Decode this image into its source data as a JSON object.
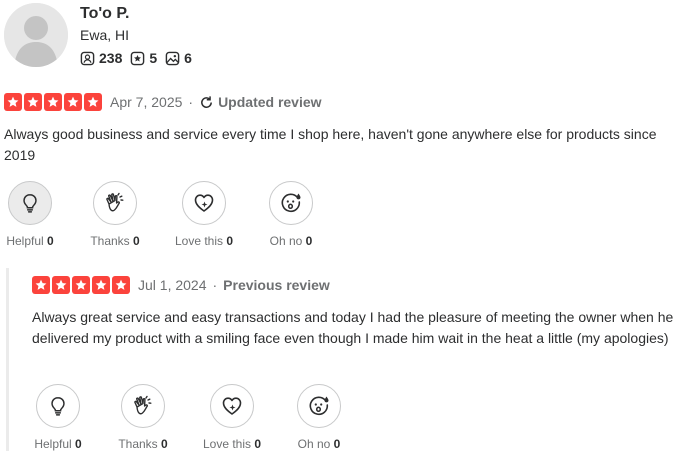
{
  "user": {
    "name": "To'o P.",
    "location": "Ewa, HI",
    "friends": "238",
    "reviews": "5",
    "photos": "6"
  },
  "current_review": {
    "rating": 5,
    "date": "Apr 7, 2025",
    "status": "Updated review",
    "text": "Always good business and service every time I shop here, haven't gone anywhere else for products since 2019",
    "reactions": [
      {
        "label": "Helpful",
        "count": "0",
        "icon": "lightbulb-icon"
      },
      {
        "label": "Thanks",
        "count": "0",
        "icon": "clapping-hands-icon"
      },
      {
        "label": "Love this",
        "count": "0",
        "icon": "heart-icon"
      },
      {
        "label": "Oh no",
        "count": "0",
        "icon": "surprised-face-icon"
      }
    ]
  },
  "previous_review": {
    "rating": 5,
    "date": "Jul 1, 2024",
    "status": "Previous review",
    "text": "Always great service and easy transactions and today I had the pleasure of meeting the owner when he delivered my product with a smiling face even though I made him wait in the heat a little (my apologies)",
    "reactions": [
      {
        "label": "Helpful",
        "count": "0",
        "icon": "lightbulb-icon"
      },
      {
        "label": "Thanks",
        "count": "0",
        "icon": "clapping-hands-icon"
      },
      {
        "label": "Love this",
        "count": "0",
        "icon": "heart-icon"
      },
      {
        "label": "Oh no",
        "count": "0",
        "icon": "surprised-face-icon"
      }
    ]
  },
  "colors": {
    "star": "#fb433c",
    "text": "#2d2e2f",
    "muted": "#6e7072"
  }
}
